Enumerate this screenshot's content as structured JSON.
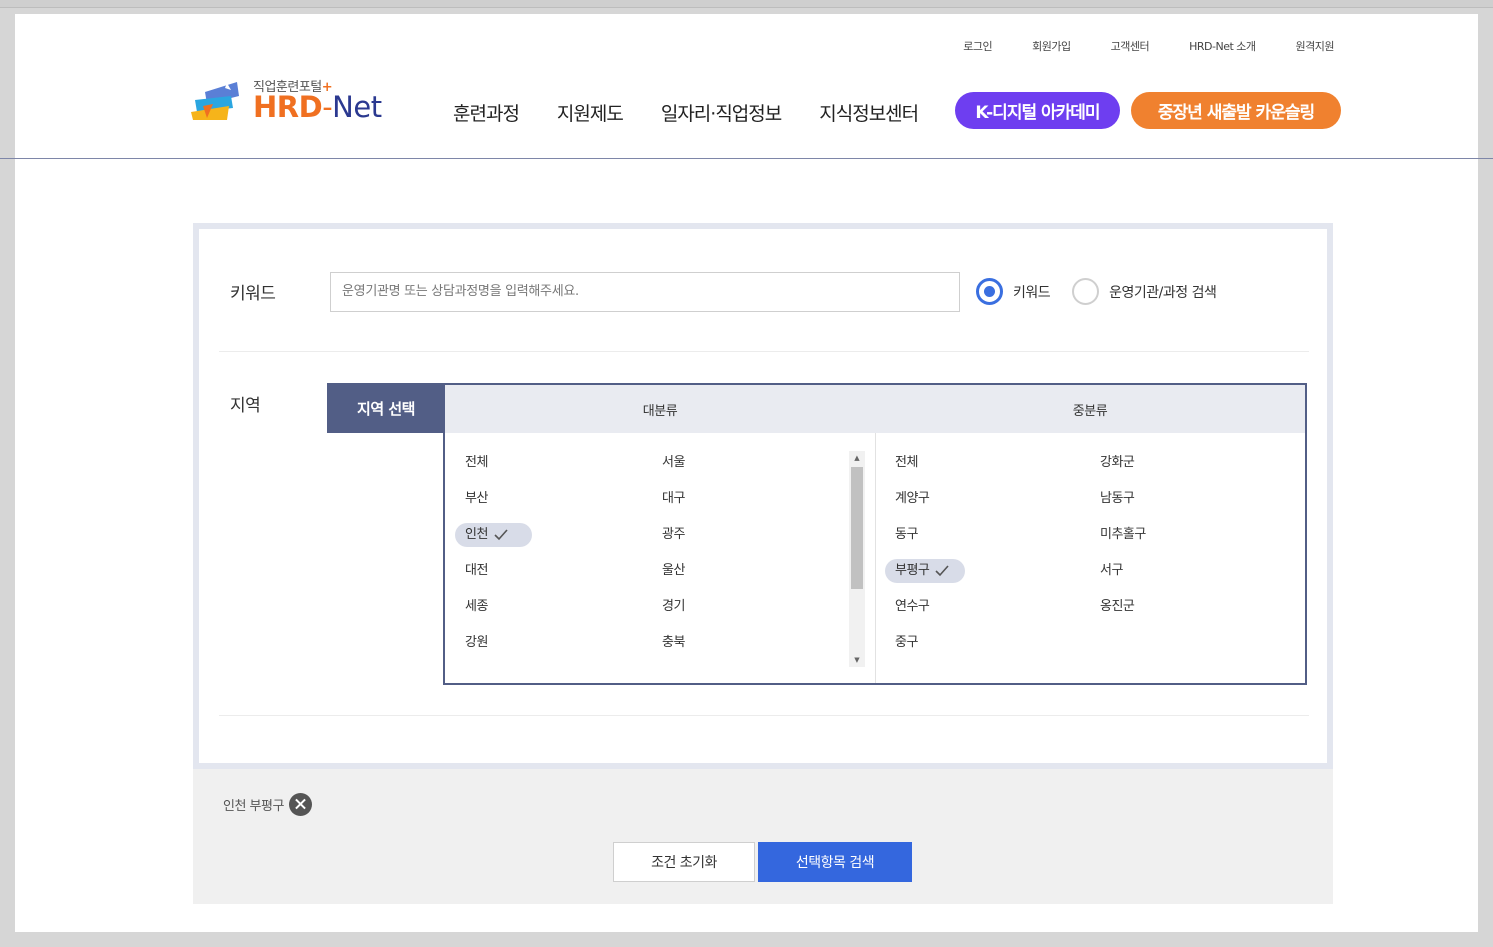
{
  "header": {
    "util_links": [
      "로그인",
      "회원가입",
      "고객센터",
      "HRD-Net 소개",
      "원격지원"
    ],
    "logo_sub": "직업훈련포털",
    "logo_plus": "+",
    "logo_hrd": "HRD",
    "logo_dash": "-",
    "logo_net": "Net",
    "gnb": [
      "훈련과정",
      "지원제도",
      "일자리·직업정보",
      "지식정보센터"
    ],
    "kdigital": "K-디지털 아카데미",
    "counsel": "중장년 새출발 카운슬링",
    "colors": {
      "kdigital": "#6e3ef0",
      "counsel": "#f0812f",
      "brand": "#f07021"
    }
  },
  "search": {
    "keyword_label": "키워드",
    "keyword_placeholder": "운영기관명 또는 상담과정명을 입력해주세요.",
    "keyword_value": "",
    "radio_keyword": "키워드",
    "radio_org": "운영기관/과정 검색",
    "radio_selected": "키워드",
    "region_label": "지역",
    "region_tab": "지역 선택",
    "major_header": "대분류",
    "mid_header": "중분류",
    "major": [
      "전체",
      "서울",
      "부산",
      "대구",
      "인천",
      "광주",
      "대전",
      "울산",
      "세종",
      "경기",
      "강원",
      "충북"
    ],
    "major_selected": "인천",
    "mid": [
      "전체",
      "강화군",
      "계양구",
      "남동구",
      "동구",
      "미추홀구",
      "부평구",
      "서구",
      "연수구",
      "옹진군",
      "중구"
    ],
    "mid_selected": "부평구"
  },
  "selected": {
    "chip": "인천 부평구",
    "reset": "조건 초기화",
    "search": "선택항목 검색"
  }
}
